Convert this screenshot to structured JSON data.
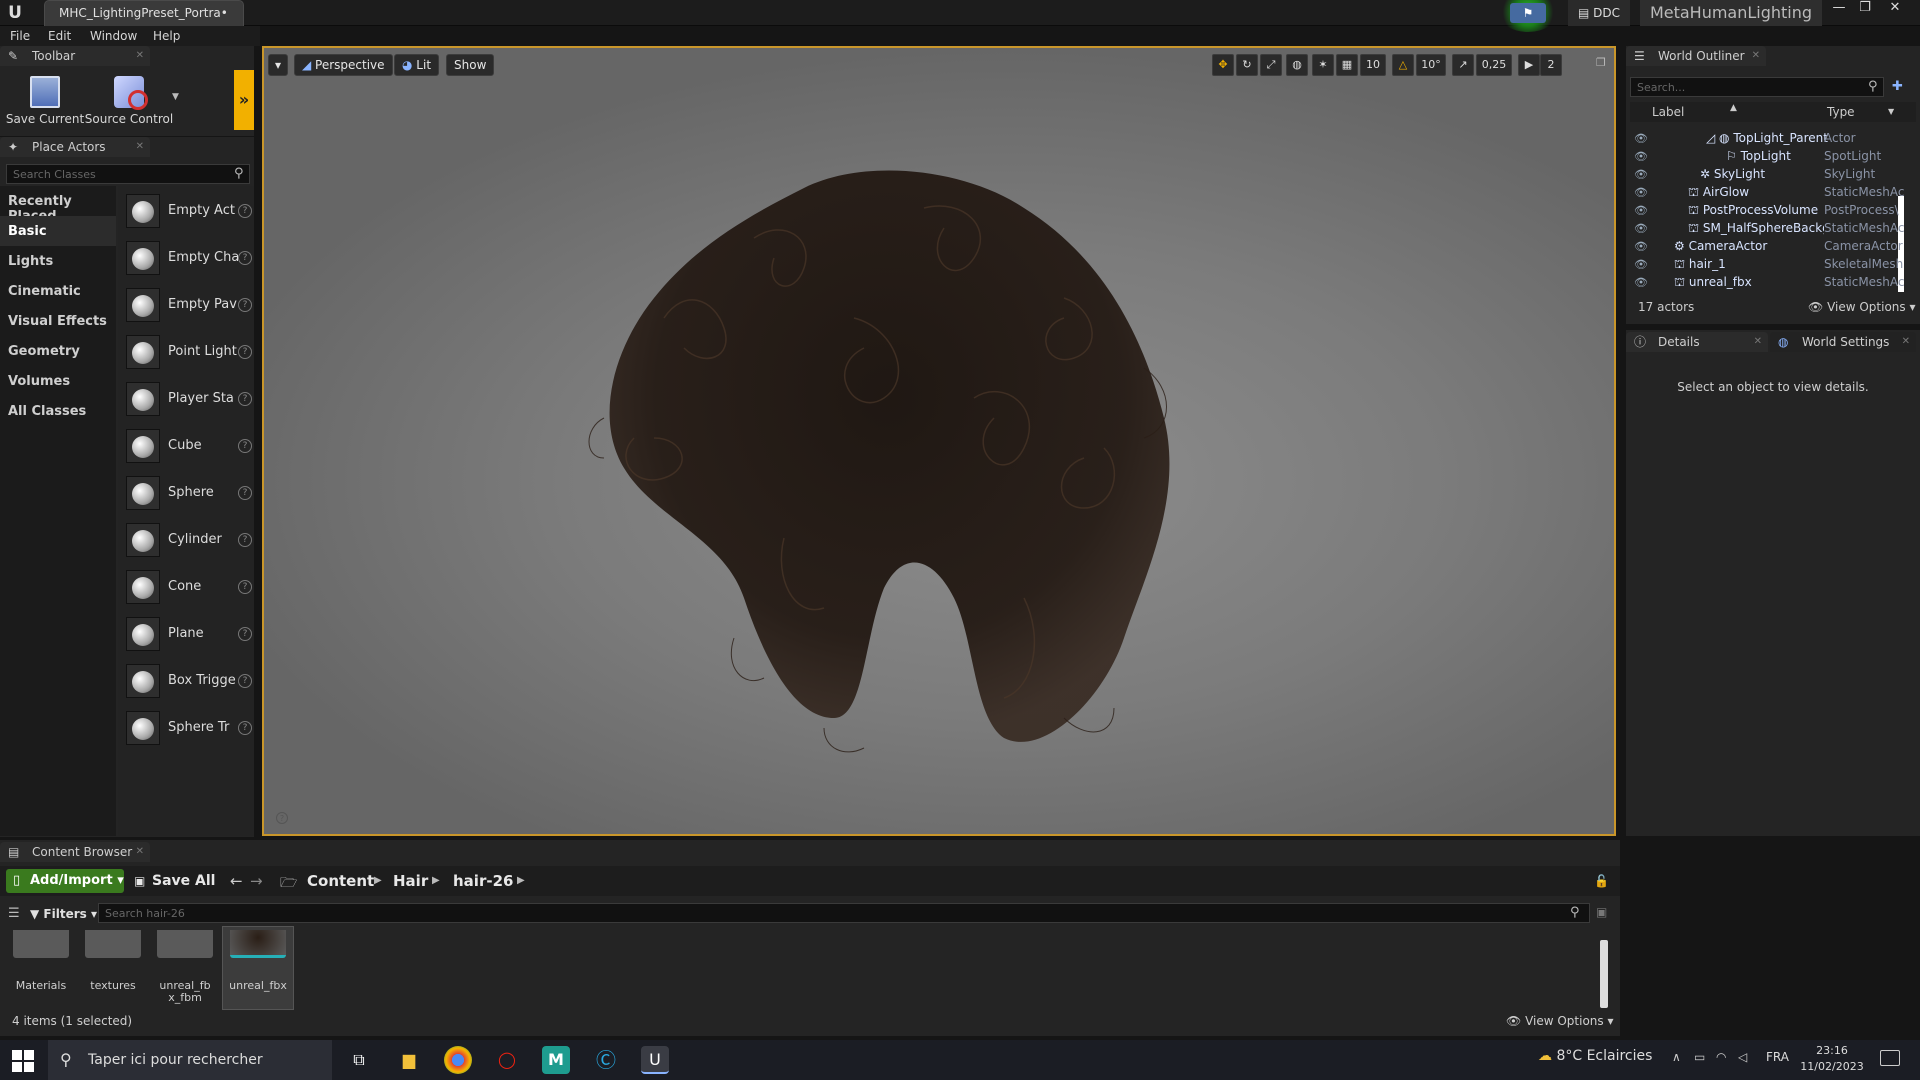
{
  "titlebar": {
    "doc_tab": "MHC_LightingPreset_Portra•",
    "ddc": "DDC",
    "project": "MetaHumanLighting",
    "min": "—",
    "max": "❐",
    "close": "✕"
  },
  "menu": [
    "File",
    "Edit",
    "Window",
    "Help"
  ],
  "toolbar": {
    "tab": "Toolbar",
    "save_current": "Save Current",
    "source_control": "Source Control"
  },
  "place_actors": {
    "tab": "Place Actors",
    "search_placeholder": "Search Classes",
    "categories": [
      "Recently Placed",
      "Basic",
      "Lights",
      "Cinematic",
      "Visual Effects",
      "Geometry",
      "Volumes",
      "All Classes"
    ],
    "items": [
      "Empty Act",
      "Empty Cha",
      "Empty Pav",
      "Point Light",
      "Player Sta",
      "Cube",
      "Sphere",
      "Cylinder",
      "Cone",
      "Plane",
      "Box Trigge",
      "Sphere Tr"
    ]
  },
  "viewport": {
    "perspective": "Perspective",
    "lit": "Lit",
    "show": "Show",
    "grid_snap": "10",
    "rot_snap": "10°",
    "scale_snap": "0,25",
    "cam_speed": "2"
  },
  "outliner": {
    "tab": "World Outliner",
    "search_placeholder": "Search...",
    "col_label": "Label",
    "col_type": "Type",
    "rows": [
      {
        "label": "TopLight_Parent",
        "type": "Actor",
        "indent": 2
      },
      {
        "label": "TopLight",
        "type": "SpotLight",
        "indent": 3
      },
      {
        "label": "SkyLight",
        "type": "SkyLight",
        "indent": 2
      },
      {
        "label": "AirGlow",
        "type": "StaticMeshAc",
        "indent": 1
      },
      {
        "label": "PostProcessVolume",
        "type": "PostProcess\\",
        "indent": 1
      },
      {
        "label": "SM_HalfSphereBackg",
        "type": "StaticMeshAc",
        "indent": 1
      },
      {
        "label": "CameraActor",
        "type": "CameraActor",
        "indent": 0
      },
      {
        "label": "hair_1",
        "type": "SkeletalMesh",
        "indent": 0
      },
      {
        "label": "unreal_fbx",
        "type": "StaticMeshAc",
        "indent": 0
      }
    ],
    "count": "17 actors",
    "view_options": "View Options"
  },
  "details": {
    "tab": "Details",
    "world_settings_tab": "World Settings",
    "empty_msg": "Select an object to view details."
  },
  "content_browser": {
    "tab": "Content Browser",
    "add_import": "Add/Import",
    "save_all": "Save All",
    "breadcrumbs": [
      "Content",
      "Hair",
      "hair-26"
    ],
    "filters": "Filters",
    "search_placeholder": "Search hair-26",
    "assets": [
      {
        "name": "Materials",
        "selected": false
      },
      {
        "name": "textures",
        "selected": false
      },
      {
        "name": "unreal_fbx_fbm",
        "selected": false
      },
      {
        "name": "unreal_fbx",
        "selected": true
      }
    ],
    "count": "4 items (1 selected)",
    "view_options": "View Options"
  },
  "taskbar": {
    "search": "Taper ici pour rechercher",
    "weather": "8°C  Eclaircies",
    "lang": "FRA",
    "time": "23:16",
    "date": "11/02/2023"
  },
  "colors": {
    "accent": "#c9962a",
    "add_import": "#3a7a1e",
    "expander": "#f2b000"
  }
}
